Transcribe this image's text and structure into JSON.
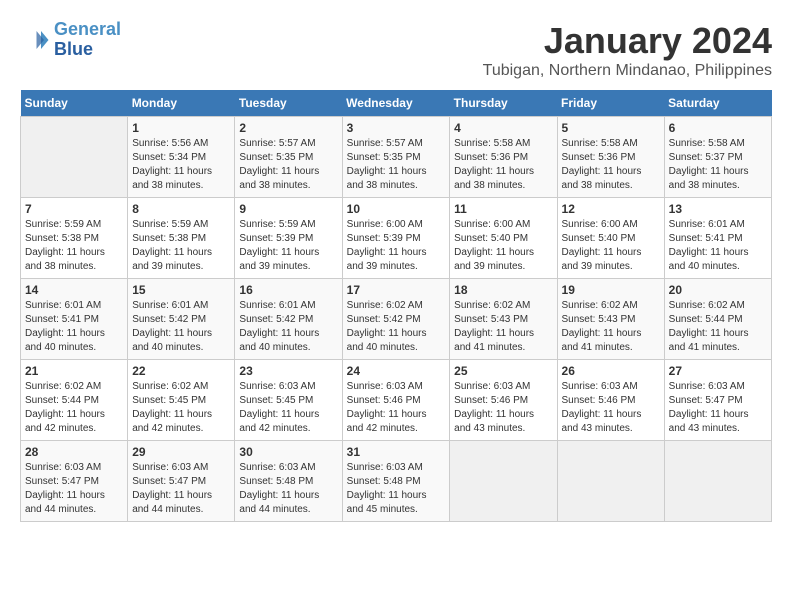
{
  "header": {
    "logo_line1": "General",
    "logo_line2": "Blue",
    "month": "January 2024",
    "location": "Tubigan, Northern Mindanao, Philippines"
  },
  "weekdays": [
    "Sunday",
    "Monday",
    "Tuesday",
    "Wednesday",
    "Thursday",
    "Friday",
    "Saturday"
  ],
  "weeks": [
    [
      {
        "day": "",
        "info": ""
      },
      {
        "day": "1",
        "info": "Sunrise: 5:56 AM\nSunset: 5:34 PM\nDaylight: 11 hours\nand 38 minutes."
      },
      {
        "day": "2",
        "info": "Sunrise: 5:57 AM\nSunset: 5:35 PM\nDaylight: 11 hours\nand 38 minutes."
      },
      {
        "day": "3",
        "info": "Sunrise: 5:57 AM\nSunset: 5:35 PM\nDaylight: 11 hours\nand 38 minutes."
      },
      {
        "day": "4",
        "info": "Sunrise: 5:58 AM\nSunset: 5:36 PM\nDaylight: 11 hours\nand 38 minutes."
      },
      {
        "day": "5",
        "info": "Sunrise: 5:58 AM\nSunset: 5:36 PM\nDaylight: 11 hours\nand 38 minutes."
      },
      {
        "day": "6",
        "info": "Sunrise: 5:58 AM\nSunset: 5:37 PM\nDaylight: 11 hours\nand 38 minutes."
      }
    ],
    [
      {
        "day": "7",
        "info": "Sunrise: 5:59 AM\nSunset: 5:38 PM\nDaylight: 11 hours\nand 38 minutes."
      },
      {
        "day": "8",
        "info": "Sunrise: 5:59 AM\nSunset: 5:38 PM\nDaylight: 11 hours\nand 39 minutes."
      },
      {
        "day": "9",
        "info": "Sunrise: 5:59 AM\nSunset: 5:39 PM\nDaylight: 11 hours\nand 39 minutes."
      },
      {
        "day": "10",
        "info": "Sunrise: 6:00 AM\nSunset: 5:39 PM\nDaylight: 11 hours\nand 39 minutes."
      },
      {
        "day": "11",
        "info": "Sunrise: 6:00 AM\nSunset: 5:40 PM\nDaylight: 11 hours\nand 39 minutes."
      },
      {
        "day": "12",
        "info": "Sunrise: 6:00 AM\nSunset: 5:40 PM\nDaylight: 11 hours\nand 39 minutes."
      },
      {
        "day": "13",
        "info": "Sunrise: 6:01 AM\nSunset: 5:41 PM\nDaylight: 11 hours\nand 40 minutes."
      }
    ],
    [
      {
        "day": "14",
        "info": "Sunrise: 6:01 AM\nSunset: 5:41 PM\nDaylight: 11 hours\nand 40 minutes."
      },
      {
        "day": "15",
        "info": "Sunrise: 6:01 AM\nSunset: 5:42 PM\nDaylight: 11 hours\nand 40 minutes."
      },
      {
        "day": "16",
        "info": "Sunrise: 6:01 AM\nSunset: 5:42 PM\nDaylight: 11 hours\nand 40 minutes."
      },
      {
        "day": "17",
        "info": "Sunrise: 6:02 AM\nSunset: 5:42 PM\nDaylight: 11 hours\nand 40 minutes."
      },
      {
        "day": "18",
        "info": "Sunrise: 6:02 AM\nSunset: 5:43 PM\nDaylight: 11 hours\nand 41 minutes."
      },
      {
        "day": "19",
        "info": "Sunrise: 6:02 AM\nSunset: 5:43 PM\nDaylight: 11 hours\nand 41 minutes."
      },
      {
        "day": "20",
        "info": "Sunrise: 6:02 AM\nSunset: 5:44 PM\nDaylight: 11 hours\nand 41 minutes."
      }
    ],
    [
      {
        "day": "21",
        "info": "Sunrise: 6:02 AM\nSunset: 5:44 PM\nDaylight: 11 hours\nand 42 minutes."
      },
      {
        "day": "22",
        "info": "Sunrise: 6:02 AM\nSunset: 5:45 PM\nDaylight: 11 hours\nand 42 minutes."
      },
      {
        "day": "23",
        "info": "Sunrise: 6:03 AM\nSunset: 5:45 PM\nDaylight: 11 hours\nand 42 minutes."
      },
      {
        "day": "24",
        "info": "Sunrise: 6:03 AM\nSunset: 5:46 PM\nDaylight: 11 hours\nand 42 minutes."
      },
      {
        "day": "25",
        "info": "Sunrise: 6:03 AM\nSunset: 5:46 PM\nDaylight: 11 hours\nand 43 minutes."
      },
      {
        "day": "26",
        "info": "Sunrise: 6:03 AM\nSunset: 5:46 PM\nDaylight: 11 hours\nand 43 minutes."
      },
      {
        "day": "27",
        "info": "Sunrise: 6:03 AM\nSunset: 5:47 PM\nDaylight: 11 hours\nand 43 minutes."
      }
    ],
    [
      {
        "day": "28",
        "info": "Sunrise: 6:03 AM\nSunset: 5:47 PM\nDaylight: 11 hours\nand 44 minutes."
      },
      {
        "day": "29",
        "info": "Sunrise: 6:03 AM\nSunset: 5:47 PM\nDaylight: 11 hours\nand 44 minutes."
      },
      {
        "day": "30",
        "info": "Sunrise: 6:03 AM\nSunset: 5:48 PM\nDaylight: 11 hours\nand 44 minutes."
      },
      {
        "day": "31",
        "info": "Sunrise: 6:03 AM\nSunset: 5:48 PM\nDaylight: 11 hours\nand 45 minutes."
      },
      {
        "day": "",
        "info": ""
      },
      {
        "day": "",
        "info": ""
      },
      {
        "day": "",
        "info": ""
      }
    ]
  ]
}
